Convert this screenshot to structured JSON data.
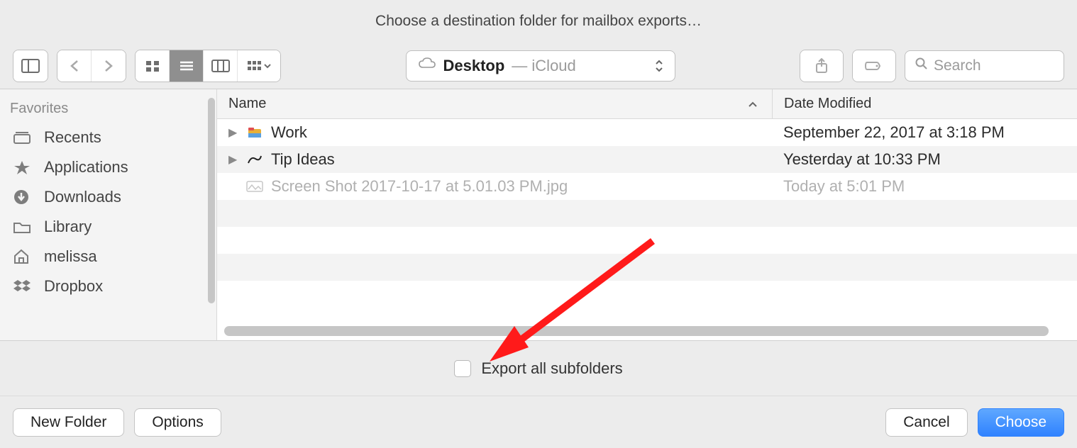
{
  "title": "Choose a destination folder for mailbox exports…",
  "toolbar": {
    "location_primary": "Desktop",
    "location_secondary": " — iCloud",
    "search_placeholder": "Search"
  },
  "sidebar": {
    "heading": "Favorites",
    "items": [
      {
        "label": "Recents"
      },
      {
        "label": "Applications"
      },
      {
        "label": "Downloads"
      },
      {
        "label": "Library"
      },
      {
        "label": "melissa"
      },
      {
        "label": "Dropbox"
      }
    ]
  },
  "columns": {
    "name": "Name",
    "date": "Date Modified"
  },
  "rows": [
    {
      "name": "Work",
      "date": "September 22, 2017 at 3:18 PM",
      "folder": true,
      "disabled": false
    },
    {
      "name": "Tip Ideas",
      "date": "Yesterday at 10:33 PM",
      "folder": true,
      "disabled": false
    },
    {
      "name": "Screen Shot 2017-10-17 at 5.01.03 PM.jpg",
      "date": "Today at 5:01 PM",
      "folder": false,
      "disabled": true
    }
  ],
  "checkbox": {
    "label": "Export all subfolders",
    "checked": false
  },
  "buttons": {
    "new_folder": "New Folder",
    "options": "Options",
    "cancel": "Cancel",
    "choose": "Choose"
  }
}
